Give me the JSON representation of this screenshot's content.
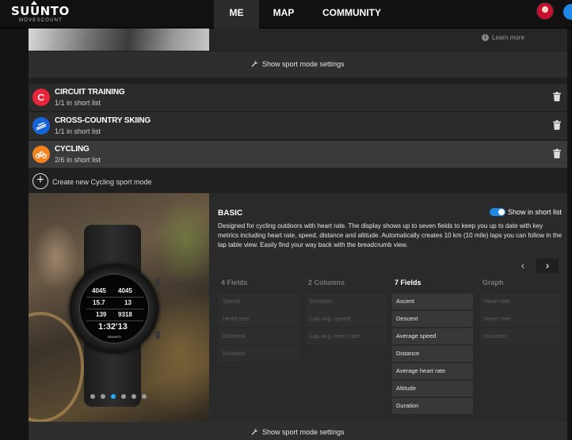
{
  "brand": {
    "name": "SUUNTO",
    "sub": "MOVESCOUNT"
  },
  "nav": {
    "items": [
      "ME",
      "MAP",
      "COMMUNITY"
    ],
    "active": "ME"
  },
  "top_panel": {
    "learn_more": "Learn more"
  },
  "settings": {
    "label": "Show sport mode settings"
  },
  "sports": [
    {
      "name": "CIRCUIT TRAINING",
      "sub": "1/1 in short list",
      "color": "#e8253a"
    },
    {
      "name": "CROSS-COUNTRY SKIING",
      "sub": "1/1 in short list",
      "color": "#1565d8"
    },
    {
      "name": "CYCLING",
      "sub": "2/6 in short list",
      "color": "#f5821f"
    }
  ],
  "create": {
    "label": "Create new Cycling sport mode"
  },
  "detail": {
    "title": "BASIC",
    "toggle_label": "Show in short list",
    "toggle_on": true,
    "description": "Designed for cycling outdoors with heart rate. The display shows up to seven fields to keep you up to date with key metrics including heart rate, speed, distance and altitude. Automatically creates 10 km (10 mile) laps you can follow in the lap table view. Easily find your way back with the breadcrumb view.",
    "prev": "‹",
    "next": "›",
    "watch": {
      "r1a": "4045",
      "r1b": "4045",
      "r2a": "15.7",
      "r2b": "13",
      "r3a": "139",
      "r3b": "9318",
      "time": "1:32'13",
      "brand": "SUUNTO"
    },
    "columns": [
      {
        "title": "4 Fields",
        "fields": [
          "Speed",
          "Heart rate",
          "Distance",
          "Duration"
        ],
        "active": false
      },
      {
        "title": "2 Columns",
        "fields": [
          "Duration",
          "Lap avg. speed",
          "Lap avg. heart rate"
        ],
        "active": false
      },
      {
        "title": "7 Fields",
        "fields": [
          "Ascent",
          "Descent",
          "Average speed",
          "Distance",
          "Average heart rate",
          "Altitude",
          "Duration"
        ],
        "active": true
      },
      {
        "title": "Graph",
        "fields": [
          "Heart rate",
          "Heart rate",
          "Duration"
        ],
        "active": false
      }
    ],
    "carousel": {
      "count": 6,
      "active_index": 2
    }
  }
}
